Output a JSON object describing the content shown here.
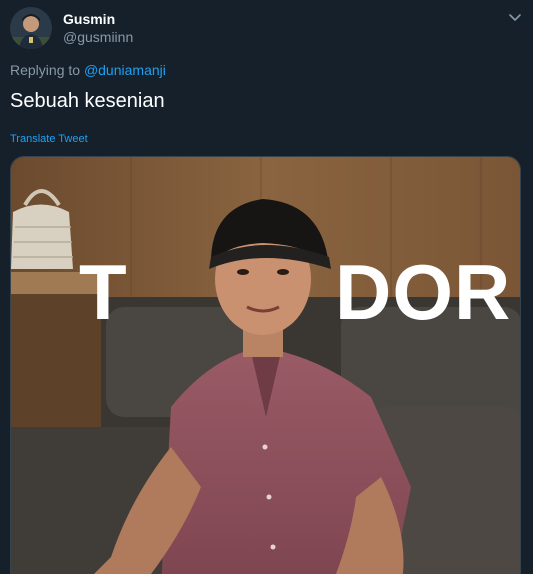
{
  "user": {
    "display_name": "Gusmin",
    "handle": "@gusmiinn"
  },
  "reply": {
    "prefix": "Replying to",
    "mention": "@duniamanji"
  },
  "tweet": {
    "text": "Sebuah kesenian",
    "translate_label": "Translate Tweet"
  },
  "media": {
    "overlay_left": "T",
    "overlay_right": "DOR"
  },
  "icons": {
    "caret": "chevron-down-icon",
    "avatar": "avatar"
  },
  "colors": {
    "background": "#15202b",
    "accent": "#1da1f2",
    "muted": "#8899a6"
  }
}
